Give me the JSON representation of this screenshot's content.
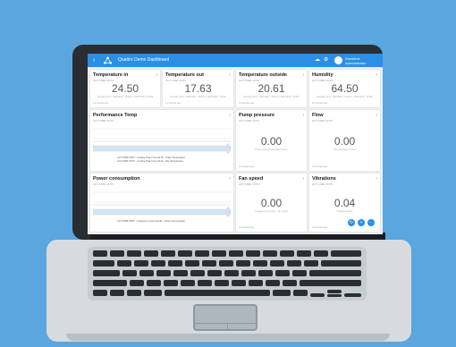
{
  "app": {
    "title": "Quattro Demo Dashboard",
    "user_line1": "Sunshine",
    "user_line2": "Administrator",
    "accent": "#2b8fe5",
    "icons": [
      "chevron-left-icon",
      "network-logo-icon",
      "cloud-icon",
      "settings-icon",
      "user-avatar-icon"
    ]
  },
  "cards": {
    "temp_in": {
      "title": "Temperature in",
      "sub": "ACT-TABF-VNTX",
      "value": "24.50",
      "desc": "Average (from: 18/07/2017, 00:00 to: 18/07/2017, 23:59)",
      "foot": "13 minutes ago"
    },
    "temp_out": {
      "title": "Temperature out",
      "sub": "ACT-TABF-VNTX",
      "value": "17.63",
      "desc": "Average (from: 18/07/2017, 00:00 to: 18/07/2017, 23:59)",
      "foot": "13 minutes ago"
    },
    "temp_outside": {
      "title": "Temperature outside",
      "sub": "ACT-TABF-VNTX",
      "value": "20.61",
      "desc": "Average (from: 18/07/2017, 00:00 to: 18/07/2017, 23:59)",
      "foot": "13 minutes ago"
    },
    "humidity": {
      "title": "Humidity",
      "sub": "ACT-TABF-VNTX",
      "value": "64.50",
      "desc": "Average (from: 18/07/2017, 00:00 to: 18/07/2017, 23:59)",
      "foot": "13 minutes ago"
    },
    "performance_temp": {
      "title": "Performance Temp",
      "sub": "ACT-TABF-VNTX",
      "legend1": "ACT-TABF-VNTX - Cooling Tower Council ID - Outlet Temperature",
      "legend2": "ACT-TABF-VNTX - Cooling Tower Council ID - Inlet Temperature"
    },
    "pump_pressure": {
      "title": "Pump pressure",
      "sub": "ACT-TABF-VNTX",
      "value": "0.00",
      "desc": "Pump pressure (average 1 hour)",
      "foot": "13 minutes ago"
    },
    "flow": {
      "title": "Flow",
      "sub": "ACT-TABF-VNTX",
      "value": "0.00",
      "desc": "Flow (average 1 hour)",
      "foot": "13 minutes ago"
    },
    "power_consumption": {
      "title": "Power consumption",
      "sub": "ACT-TABF-VNTX",
      "legend1": "ACT-TABF-VNTX - Frequency Converter 86 - Power Consumption"
    },
    "fan_speed": {
      "title": "Fan speed",
      "sub": "ACT-TABF-VNTX",
      "value": "0.00",
      "desc": "Frequency converter - fan speed",
      "foot": "13 minutes ago"
    },
    "vibrations": {
      "title": "Vibrations",
      "sub": "ACT-TABF-VNTX",
      "value": "0.04",
      "desc": "Vibration sensor",
      "foot": "13 minutes ago"
    }
  },
  "fabs": [
    "refresh-icon",
    "add-icon",
    "more-icon"
  ]
}
